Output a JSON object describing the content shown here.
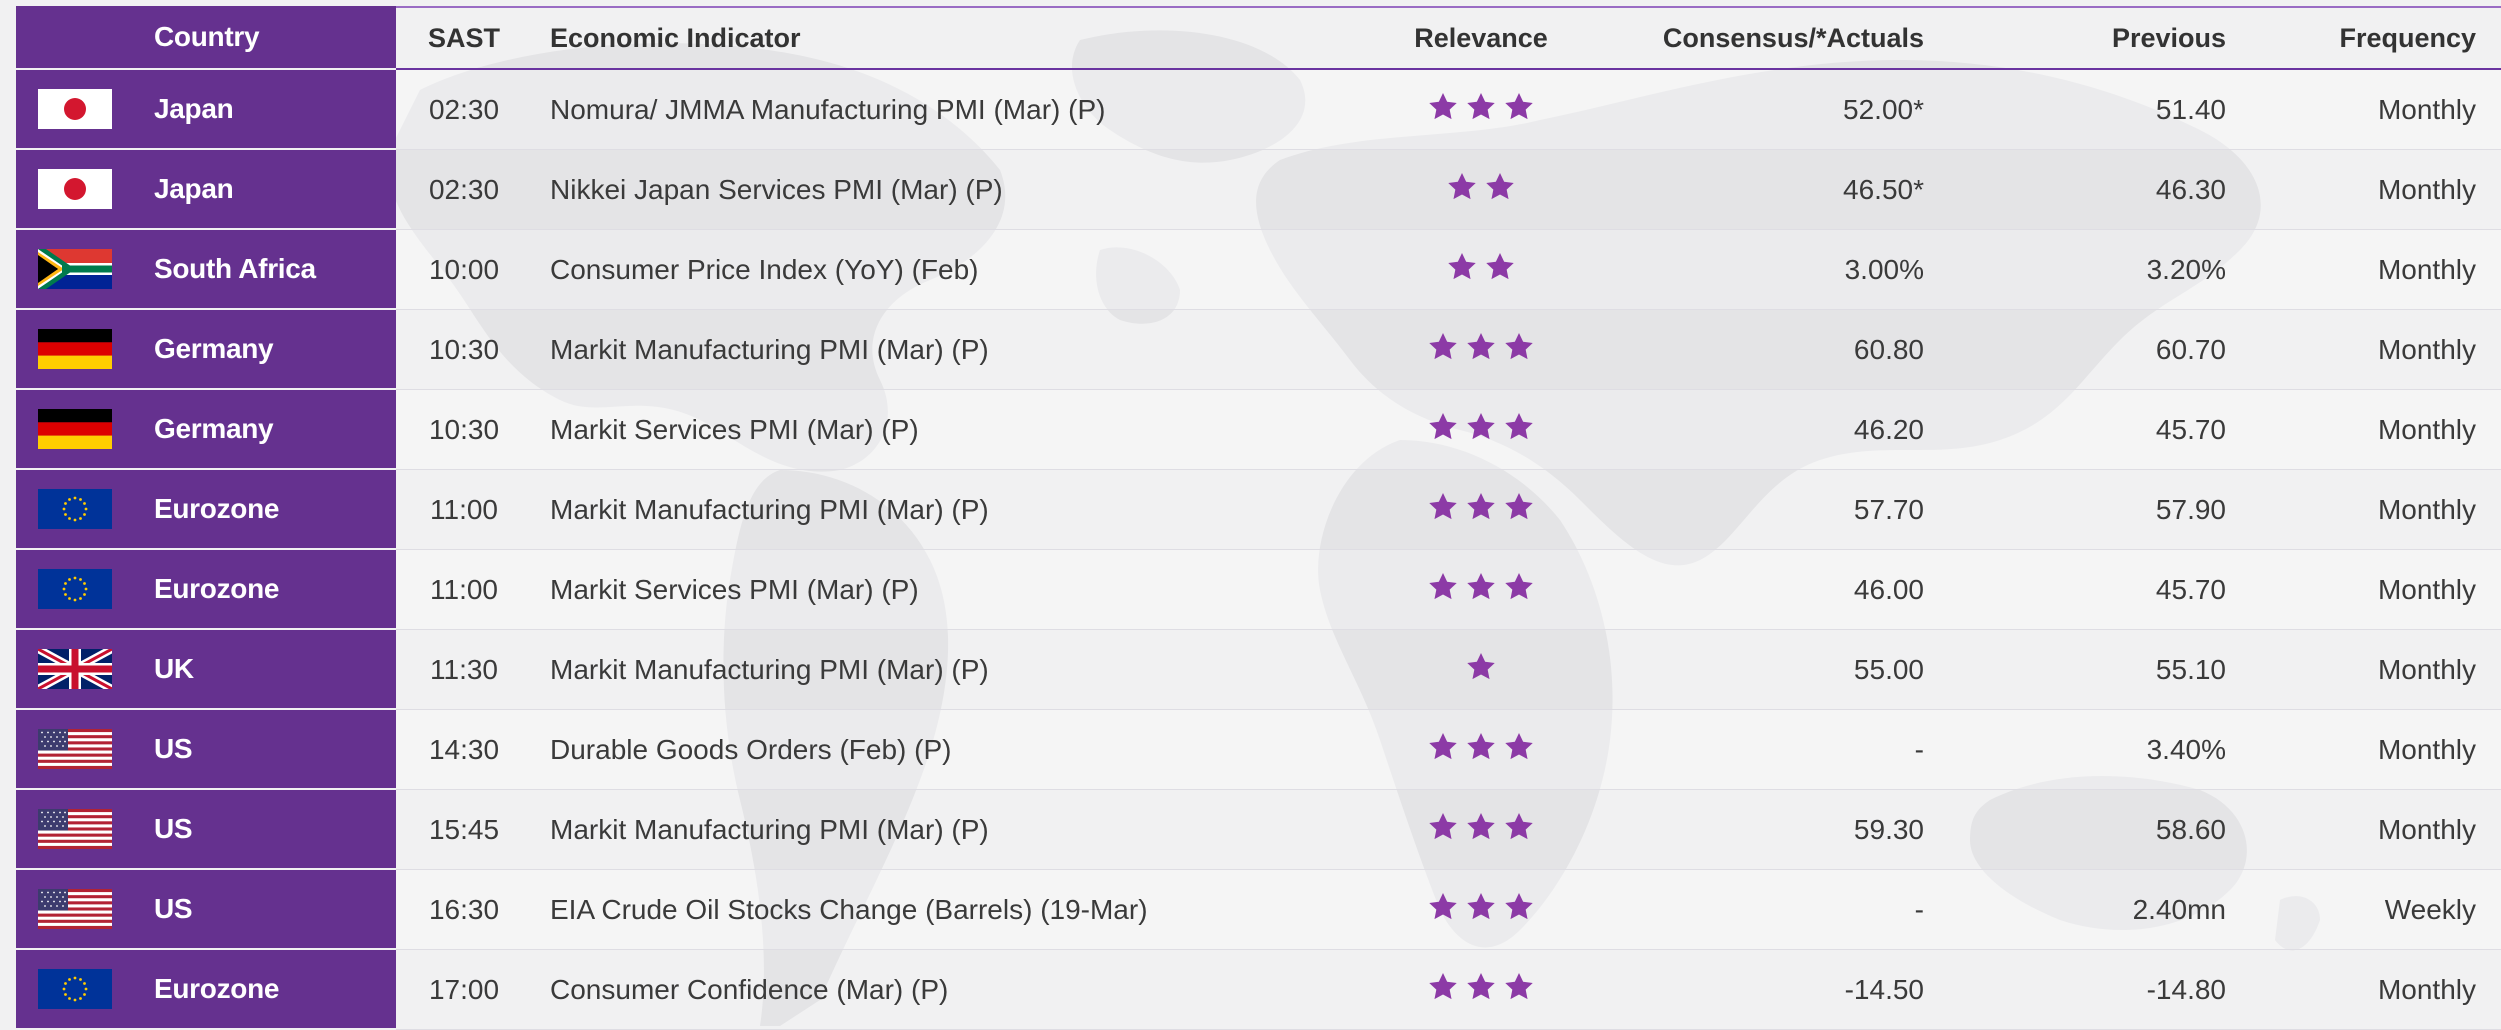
{
  "colors": {
    "country_column": "#65318f",
    "star": "#8c3aa6",
    "header_rule": "#6a34a0"
  },
  "header": {
    "country": "Country",
    "sast": "SAST",
    "indicator": "Economic Indicator",
    "relevance": "Relevance",
    "consensus": "Consensus/*Actuals",
    "previous": "Previous",
    "frequency": "Frequency"
  },
  "rows": [
    {
      "flag": "japan-flag",
      "country": "Japan",
      "sast": "02:30",
      "indicator": "Nomura/ JMMA Manufacturing PMI (Mar) (P)",
      "relevance": 3,
      "consensus": "52.00*",
      "previous": "51.40",
      "frequency": "Monthly"
    },
    {
      "flag": "japan-flag",
      "country": "Japan",
      "sast": "02:30",
      "indicator": "Nikkei Japan Services PMI (Mar) (P)",
      "relevance": 2,
      "consensus": "46.50*",
      "previous": "46.30",
      "frequency": "Monthly"
    },
    {
      "flag": "south-africa-flag",
      "country": "South Africa",
      "sast": "10:00",
      "indicator": "Consumer Price Index (YoY) (Feb)",
      "relevance": 2,
      "consensus": "3.00%",
      "previous": "3.20%",
      "frequency": "Monthly"
    },
    {
      "flag": "germany-flag",
      "country": "Germany",
      "sast": "10:30",
      "indicator": "Markit Manufacturing PMI (Mar) (P)",
      "relevance": 3,
      "consensus": "60.80",
      "previous": "60.70",
      "frequency": "Monthly"
    },
    {
      "flag": "germany-flag",
      "country": "Germany",
      "sast": "10:30",
      "indicator": "Markit Services PMI (Mar) (P)",
      "relevance": 3,
      "consensus": "46.20",
      "previous": "45.70",
      "frequency": "Monthly"
    },
    {
      "flag": "eu-flag",
      "country": "Eurozone",
      "sast": "11:00",
      "indicator": "Markit Manufacturing PMI (Mar) (P)",
      "relevance": 3,
      "consensus": "57.70",
      "previous": "57.90",
      "frequency": "Monthly"
    },
    {
      "flag": "eu-flag",
      "country": "Eurozone",
      "sast": "11:00",
      "indicator": "Markit Services PMI (Mar) (P)",
      "relevance": 3,
      "consensus": "46.00",
      "previous": "45.70",
      "frequency": "Monthly"
    },
    {
      "flag": "uk-flag",
      "country": "UK",
      "sast": "11:30",
      "indicator": "Markit Manufacturing PMI (Mar) (P)",
      "relevance": 1,
      "consensus": "55.00",
      "previous": "55.10",
      "frequency": "Monthly"
    },
    {
      "flag": "us-flag",
      "country": "US",
      "sast": "14:30",
      "indicator": "Durable Goods Orders (Feb) (P)",
      "relevance": 3,
      "consensus": "-",
      "previous": "3.40%",
      "frequency": "Monthly"
    },
    {
      "flag": "us-flag",
      "country": "US",
      "sast": "15:45",
      "indicator": "Markit Manufacturing PMI (Mar) (P)",
      "relevance": 3,
      "consensus": "59.30",
      "previous": "58.60",
      "frequency": "Monthly"
    },
    {
      "flag": "us-flag",
      "country": "US",
      "sast": "16:30",
      "indicator": "EIA Crude Oil Stocks Change (Barrels) (19-Mar)",
      "relevance": 3,
      "consensus": "-",
      "previous": "2.40mn",
      "frequency": "Weekly"
    },
    {
      "flag": "eu-flag",
      "country": "Eurozone",
      "sast": "17:00",
      "indicator": "Consumer Confidence (Mar) (P)",
      "relevance": 3,
      "consensus": "-14.50",
      "previous": "-14.80",
      "frequency": "Monthly"
    }
  ]
}
